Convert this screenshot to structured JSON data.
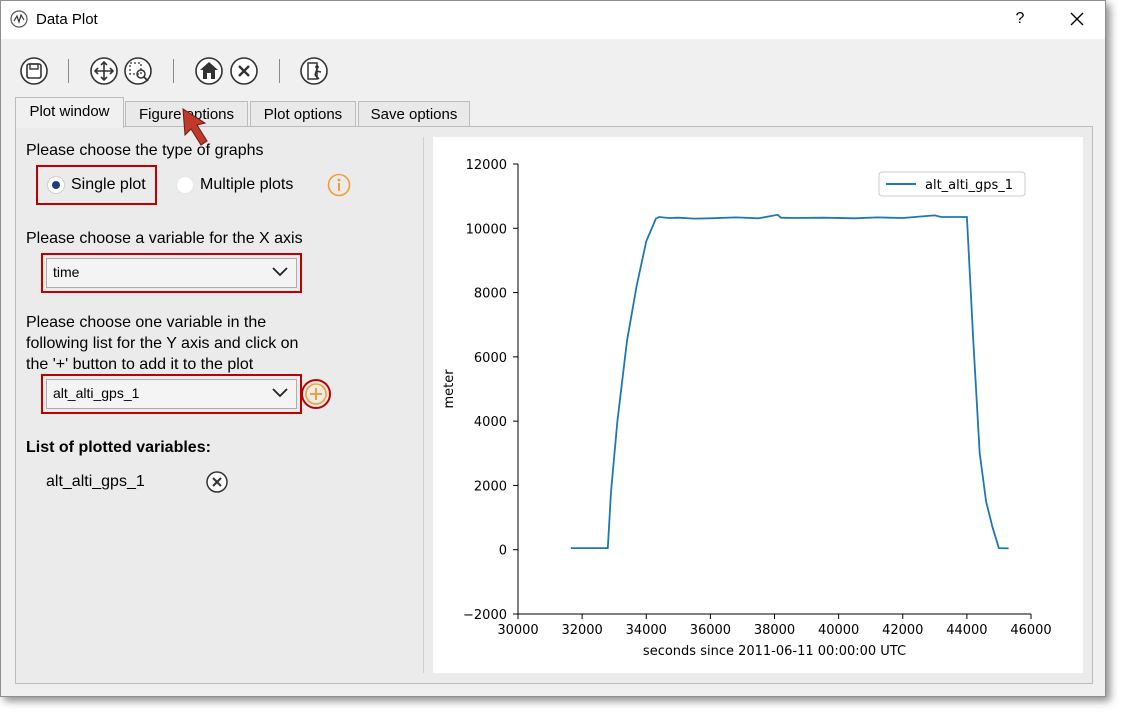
{
  "window": {
    "title": "Data Plot",
    "help_label": "?"
  },
  "toolbar": {
    "buttons": [
      "save-icon",
      "pan-icon",
      "zoom-icon",
      "home-icon",
      "clear-icon",
      "exit-icon"
    ]
  },
  "tabs": [
    {
      "label": "Plot window",
      "active": true
    },
    {
      "label": "Figure options",
      "active": false
    },
    {
      "label": "Plot options",
      "active": false
    },
    {
      "label": "Save options",
      "active": false
    }
  ],
  "form": {
    "graph_type_prompt": "Please choose the type of graphs",
    "single_plot_label": "Single plot",
    "multiple_plots_label": "Multiple plots",
    "selected_graph_type": "Single plot",
    "x_prompt": "Please choose a variable for the X axis",
    "x_value": "time",
    "y_prompt_line1": "Please choose one variable in the",
    "y_prompt_line2": "following list for the Y axis and click on",
    "y_prompt_line3": "the '+' button to add it to the plot",
    "y_value": "alt_alti_gps_1",
    "plotted_heading": "List of plotted variables:",
    "plotted": [
      "alt_alti_gps_1"
    ]
  },
  "colors": {
    "highlight": "#c00000",
    "accent": "#f0a030",
    "line": "#1f77b4",
    "radio_selected": "#1f3c86"
  },
  "chart_data": {
    "type": "line",
    "title": "",
    "xlabel": "seconds since 2011-06-11 00:00:00 UTC",
    "ylabel": "meter",
    "xlim": [
      30000,
      46000
    ],
    "ylim": [
      -2000,
      12000
    ],
    "xticks": [
      30000,
      32000,
      34000,
      36000,
      38000,
      40000,
      42000,
      44000,
      46000
    ],
    "yticks": [
      -2000,
      0,
      2000,
      4000,
      6000,
      8000,
      10000,
      12000
    ],
    "legend": "top-right",
    "grid": false,
    "series": [
      {
        "name": "alt_alti_gps_1",
        "x": [
          31650,
          32500,
          32800,
          32900,
          33100,
          33400,
          33700,
          34000,
          34300,
          34400,
          34700,
          35000,
          35500,
          36000,
          36800,
          37500,
          38100,
          38200,
          38600,
          39500,
          40500,
          41200,
          42000,
          42700,
          43000,
          43200,
          43600,
          44000,
          44200,
          44400,
          44600,
          44800,
          45000,
          45300
        ],
        "y": [
          50,
          50,
          50,
          1800,
          4000,
          6500,
          8200,
          9600,
          10300,
          10350,
          10320,
          10330,
          10300,
          10310,
          10340,
          10310,
          10420,
          10330,
          10320,
          10330,
          10310,
          10340,
          10320,
          10380,
          10400,
          10350,
          10350,
          10350,
          6500,
          3000,
          1500,
          700,
          50,
          40
        ]
      }
    ]
  }
}
